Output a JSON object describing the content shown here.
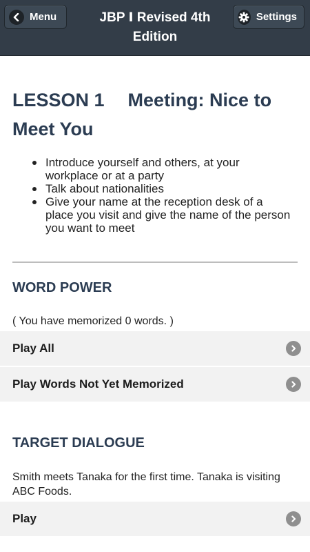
{
  "header": {
    "title": "JBP Ⅰ  Revised 4th Edition",
    "menu_label": "Menu",
    "settings_label": "Settings"
  },
  "lesson": {
    "number": "LESSON 1",
    "title": "Meeting: Nice to Meet You",
    "goals": [
      "Introduce yourself and others, at your workplace or at a party",
      "Talk about nationalities",
      "Give your name at the reception desk of a place you visit and give the name of the person you want to meet"
    ]
  },
  "word_power": {
    "heading": "WORD POWER",
    "memorized_note": "( You have memorized 0 words. )",
    "play_all_label": "Play All",
    "play_not_memorized_label": "Play Words Not Yet Memorized"
  },
  "target_dialogue": {
    "heading": "TARGET DIALOGUE",
    "description": "Smith meets Tanaka for the first time. Tanaka is visiting ABC Foods.",
    "play_label": "Play"
  },
  "icons": {
    "menu": "back-arrow-icon",
    "settings": "gear-icon",
    "rows": "chevron-right-icon"
  },
  "colors": {
    "header_bg": "#333d48",
    "heading_text": "#2b3c52",
    "row_bg": "#f2f2f2"
  }
}
